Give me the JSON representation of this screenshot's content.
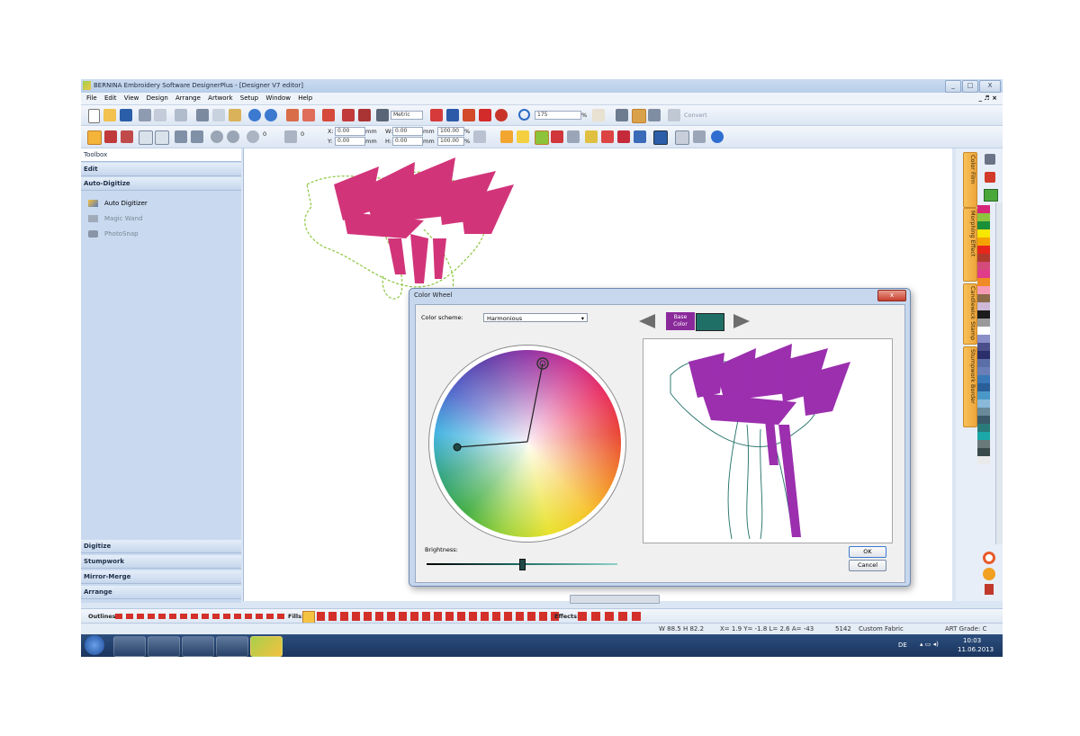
{
  "window": {
    "title": "BERNINA Embroidery Software DesignerPlus - [Designer V7 editor]",
    "controls": [
      "_",
      "□",
      "X"
    ],
    "mdi_controls": "_ ♬ ×"
  },
  "menu": [
    "File",
    "Edit",
    "View",
    "Design",
    "Arrange",
    "Artwork",
    "Setup",
    "Window",
    "Help"
  ],
  "toolbar1": {
    "units": "Metric",
    "zoom": "175",
    "zoom_unit": "%",
    "convert_label": "Convert"
  },
  "toolbar2": {
    "rotate_value": "0",
    "slant_value": "0",
    "x_label": "X:",
    "x_value": "0.00",
    "y_label": "Y:",
    "y_value": "0.00",
    "w_label": "W:",
    "w_value": "0.00",
    "h_label": "H:",
    "h_value": "0.00",
    "unit_mm": "mm",
    "scale_w": "100.00",
    "scale_h": "100.00",
    "pct": "%"
  },
  "toolbox": {
    "title": "Toolbox",
    "sections_top": [
      "Edit",
      "Auto-Digitize"
    ],
    "items": [
      "Auto Digitizer",
      "Magic Wand",
      "PhotoSnap"
    ],
    "sections_bottom": [
      "Digitize",
      "Stumpwork",
      "Mirror-Merge",
      "Arrange"
    ]
  },
  "right_tabs": [
    "Color Film",
    "Morphing Effect",
    "Candlewick Stamp",
    "Stumpwork Border"
  ],
  "palette": [
    "#d6267a",
    "#8cc63f",
    "#1a8f3a",
    "#f7e600",
    "#f5a300",
    "#e8261c",
    "#b03a2e",
    "#d44a7a",
    "#e03c8a",
    "#f08a24",
    "#f59ab5",
    "#8b6a4a",
    "#cdb8d8",
    "#1c1c1c",
    "#9a9a9a",
    "#ffffff",
    "#8a8fc8",
    "#4a4e8a",
    "#2a2e6a",
    "#5a6ea8",
    "#6a7eb8",
    "#3a78b8",
    "#2a5e98",
    "#4a98c8",
    "#8ab8d8",
    "#6a8a9a",
    "#3a5a6a",
    "#2a7a7a",
    "#1aa8a8",
    "#6a7a7a",
    "#3a4a4a",
    "#eaeaea"
  ],
  "bottom_toolbar": {
    "outlines_label": "Outlines:",
    "fills_label": "Fills:",
    "effects_label": "Effects:"
  },
  "status": {
    "dims": "W 88.5 H 82.2",
    "coords": "X= 1.9 Y= -1.8 L= 2.6 A= -43",
    "stitches": "5142",
    "fabric": "Custom Fabric",
    "grade": "ART Grade: C"
  },
  "taskbar": {
    "lang": "DE",
    "time": "10:03",
    "date": "11.06.2013"
  },
  "dialog": {
    "title": "Color Wheel",
    "close": "x",
    "scheme_label": "Color scheme:",
    "scheme_value": "Harmonious",
    "base_color_label": "Base Color",
    "base_color": "#1f6f66",
    "brightness_label": "Brightness:",
    "brightness": 0.5,
    "ok": "OK",
    "cancel": "Cancel"
  },
  "colors": {
    "accent": "#2b6fc4",
    "toolbox_bg": "#c9daf0",
    "stitch_pink": "#d2347a",
    "stitch_green": "#8cc63f",
    "preview_purple": "#9b2fae",
    "preview_teal": "#1f6f66"
  }
}
